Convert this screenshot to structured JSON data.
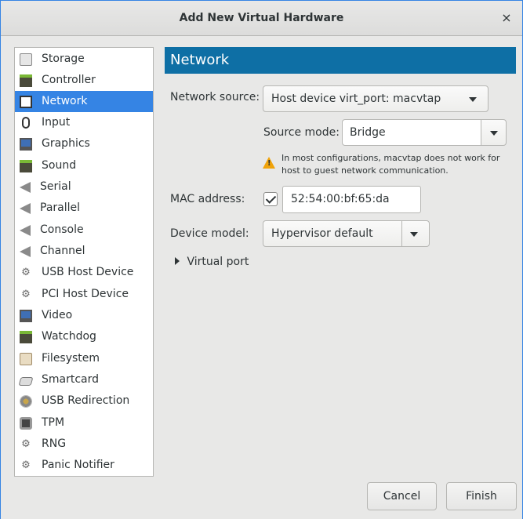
{
  "window": {
    "title": "Add New Virtual Hardware",
    "close_glyph": "×",
    "accent_color": "#3584e4",
    "header_color": "#0e6fa5"
  },
  "sidebar": {
    "items": [
      {
        "label": "Storage",
        "icon": "storage-icon"
      },
      {
        "label": "Controller",
        "icon": "controller-icon"
      },
      {
        "label": "Network",
        "icon": "network-icon",
        "selected": true
      },
      {
        "label": "Input",
        "icon": "mouse-icon"
      },
      {
        "label": "Graphics",
        "icon": "monitor-icon"
      },
      {
        "label": "Sound",
        "icon": "sound-card-icon"
      },
      {
        "label": "Serial",
        "icon": "serial-port-icon"
      },
      {
        "label": "Parallel",
        "icon": "parallel-port-icon"
      },
      {
        "label": "Console",
        "icon": "console-icon"
      },
      {
        "label": "Channel",
        "icon": "channel-icon"
      },
      {
        "label": "USB Host Device",
        "icon": "usb-device-icon"
      },
      {
        "label": "PCI Host Device",
        "icon": "pci-device-icon"
      },
      {
        "label": "Video",
        "icon": "video-monitor-icon"
      },
      {
        "label": "Watchdog",
        "icon": "watchdog-icon"
      },
      {
        "label": "Filesystem",
        "icon": "folder-icon"
      },
      {
        "label": "Smartcard",
        "icon": "smartcard-icon"
      },
      {
        "label": "USB Redirection",
        "icon": "usb-redirection-icon"
      },
      {
        "label": "TPM",
        "icon": "tpm-chip-icon"
      },
      {
        "label": "RNG",
        "icon": "rng-icon"
      },
      {
        "label": "Panic Notifier",
        "icon": "panic-notifier-icon"
      }
    ]
  },
  "main": {
    "header": "Network",
    "network_source_label": "Network source:",
    "network_source_value": "Host device virt_port: macvtap",
    "source_mode_label": "Source mode:",
    "source_mode_value": "Bridge",
    "warning_text": "In most configurations, macvtap does not work for host to guest network communication.",
    "mac_label": "MAC address:",
    "mac_checked": true,
    "mac_value": "52:54:00:bf:65:da",
    "device_model_label": "Device model:",
    "device_model_value": "Hypervisor default",
    "virtual_port_label": "Virtual port"
  },
  "buttons": {
    "cancel": "Cancel",
    "finish": "Finish"
  }
}
